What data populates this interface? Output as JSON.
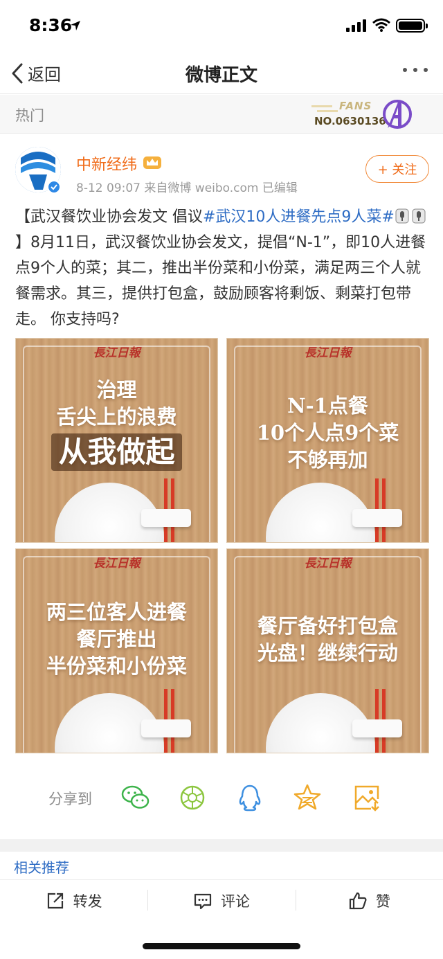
{
  "status": {
    "time": "8:36"
  },
  "nav": {
    "back_label": "返回",
    "title": "微博正文"
  },
  "hot": {
    "label": "热门",
    "fans_text": "FANS",
    "fans_no": "NO.0630136"
  },
  "author": {
    "name": "中新经纬",
    "meta": "8-12 09:07  来自微博 weibo.com  已编辑",
    "follow_label": "+ 关注"
  },
  "post": {
    "prefix": "【武汉餐饮业协会发文 倡议",
    "topic": "#武汉10人进餐先点9人菜#",
    "body": "】8月11日，武汉餐饮业协会发文，提倡“N-1”，即10人进餐点9个人的菜；其二，推出半份菜和小份菜，满足两三个人就餐需求。其三，提供打包盒，鼓励顾客将剩饭、剩菜打包带走。 你支持吗?"
  },
  "images": [
    {
      "paper": "長江日報",
      "lines": [
        "治理",
        "舌尖上的浪费"
      ],
      "highlight": "从我做起"
    },
    {
      "paper": "長江日報",
      "lines": [
        "N-1点餐",
        "10个人点9个菜",
        "不够再加"
      ]
    },
    {
      "paper": "長江日報",
      "lines": [
        "两三位客人进餐",
        "餐厅推出",
        "半份菜和小份菜"
      ]
    },
    {
      "paper": "長江日報",
      "lines": [
        "餐厅备好打包盒",
        "光盘！继续行动"
      ]
    }
  ],
  "share": {
    "label": "分享到",
    "targets": [
      "wechat-icon",
      "moments-icon",
      "qq-icon",
      "qzone-icon",
      "save-image-icon"
    ]
  },
  "related": {
    "label": "相关推荐"
  },
  "actions": {
    "repost": "转发",
    "comment": "评论",
    "like": "赞"
  },
  "colors": {
    "accent": "#f06b18",
    "link": "#2e6cc4",
    "share_green": "#3cb34a",
    "share_blue": "#3d8fe0",
    "share_gold": "#f0a92a"
  }
}
